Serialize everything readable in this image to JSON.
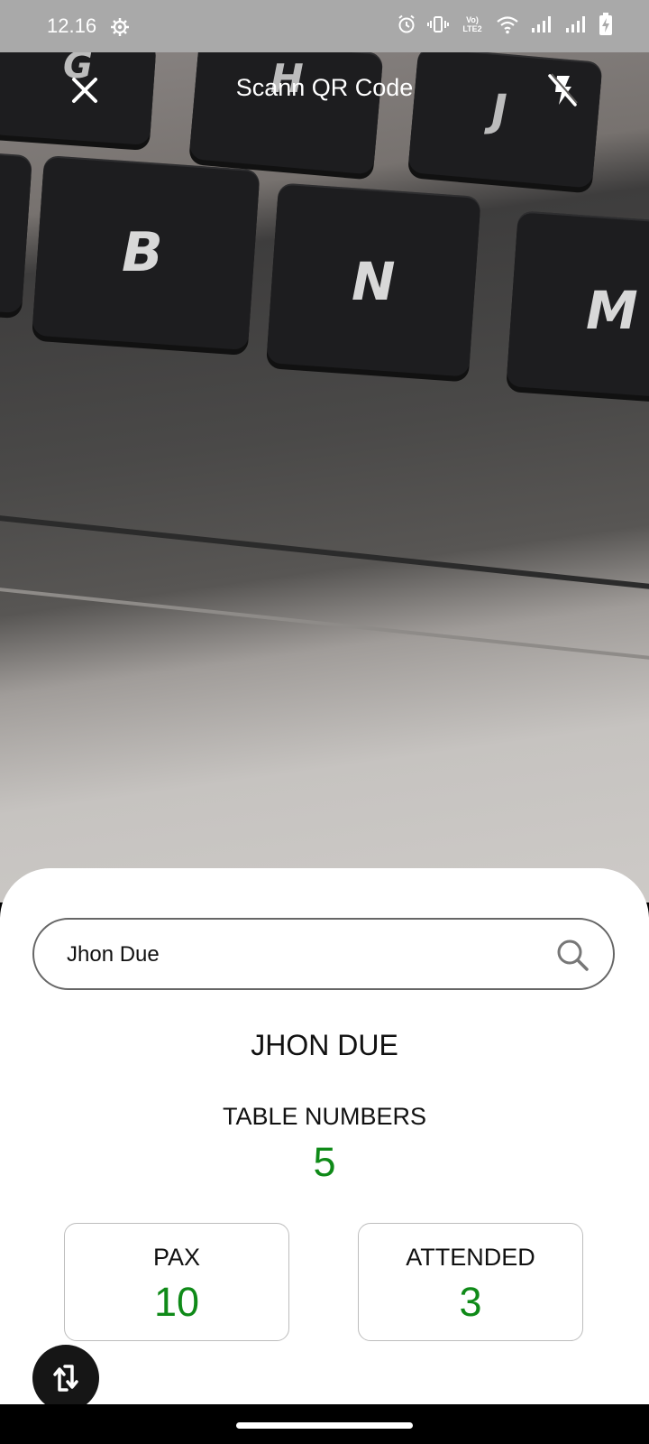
{
  "status_bar": {
    "time": "12.16",
    "icons": [
      "settings-icon",
      "alarm-icon",
      "vibrate-icon",
      "volte-icon",
      "wifi-icon",
      "signal-icon",
      "signal-icon",
      "battery-charging-icon"
    ],
    "volte_text": "Vo) LTE2"
  },
  "camera": {
    "keys": [
      "G",
      "H",
      "J",
      "B",
      "N",
      "M"
    ]
  },
  "topbar": {
    "title": "Scann QR Code",
    "close_icon": "close-icon",
    "flash_icon": "flash-off-icon"
  },
  "search": {
    "value": "Jhon Due",
    "icon": "search-icon"
  },
  "guest": {
    "name": "JHON DUE",
    "table_label": "TABLE NUMBERS",
    "table_value": "5"
  },
  "cards": [
    {
      "label": "PAX",
      "value": "10"
    },
    {
      "label": "ATTENDED",
      "value": "3"
    }
  ],
  "switch_camera_icon": "switch-camera-icon",
  "colors": {
    "accent_green": "#0f8a18",
    "status_bar": "#a9a9a9",
    "sheet": "#ffffff"
  }
}
